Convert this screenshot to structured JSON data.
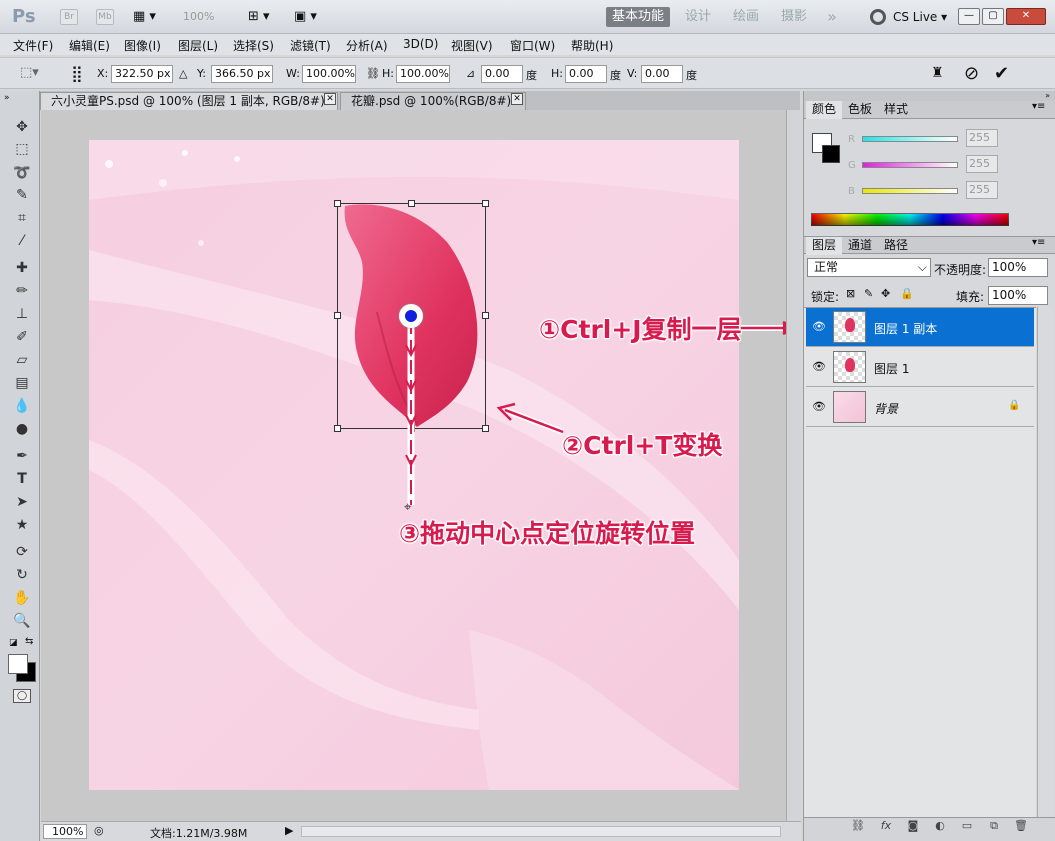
{
  "titlebar": {
    "app_logo": "Ps",
    "br": "Br",
    "mb": "Mb",
    "zoom": "100%",
    "workspaces": [
      "基本功能",
      "设计",
      "绘画",
      "摄影"
    ],
    "more": "»",
    "cslive": "CS Live"
  },
  "menu": [
    "文件(F)",
    "编辑(E)",
    "图像(I)",
    "图层(L)",
    "选择(S)",
    "滤镜(T)",
    "分析(A)",
    "3D(D)",
    "视图(V)",
    "窗口(W)",
    "帮助(H)"
  ],
  "options": {
    "x_label": "X:",
    "x_value": "322.50 px",
    "y_label": "Y:",
    "y_value": "366.50 px",
    "w_label": "W:",
    "w_value": "100.00%",
    "h_label": "H:",
    "h_value": "100.00%",
    "angle_value": "0.00",
    "deg": "度",
    "hskew_label": "H:",
    "hskew_value": "0.00",
    "vskew_label": "V:",
    "vskew_value": "0.00"
  },
  "tabs": [
    {
      "label": "六小灵童PS.psd @ 100% (图层 1 副本, RGB/8#) *",
      "active": true
    },
    {
      "label": "花瓣.psd @ 100%(RGB/8#) *",
      "active": false
    }
  ],
  "status": {
    "zoom": "100%",
    "doc": "文档:1.21M/3.98M"
  },
  "color_panel": {
    "tabs": [
      "颜色",
      "色板",
      "样式"
    ],
    "channels": [
      {
        "label": "R",
        "value": "255"
      },
      {
        "label": "G",
        "value": "255"
      },
      {
        "label": "B",
        "value": "255"
      }
    ]
  },
  "layers_panel": {
    "tabs": [
      "图层",
      "通道",
      "路径"
    ],
    "blend_mode": "正常",
    "opacity_label": "不透明度:",
    "opacity": "100%",
    "lock_label": "锁定:",
    "fill_label": "填充:",
    "fill": "100%",
    "layers": [
      {
        "name": "图层 1 副本",
        "selected": true
      },
      {
        "name": "图层 1",
        "selected": false
      },
      {
        "name": "背景",
        "selected": false,
        "locked": true
      }
    ]
  },
  "annotations": {
    "step1": "①Ctrl+J复制一层",
    "step2": "②Ctrl+T变换",
    "step3": "③拖动中心点定位旋转位置"
  },
  "colors": {
    "accent": "#0a70d1",
    "annotation": "#d81b4e"
  }
}
